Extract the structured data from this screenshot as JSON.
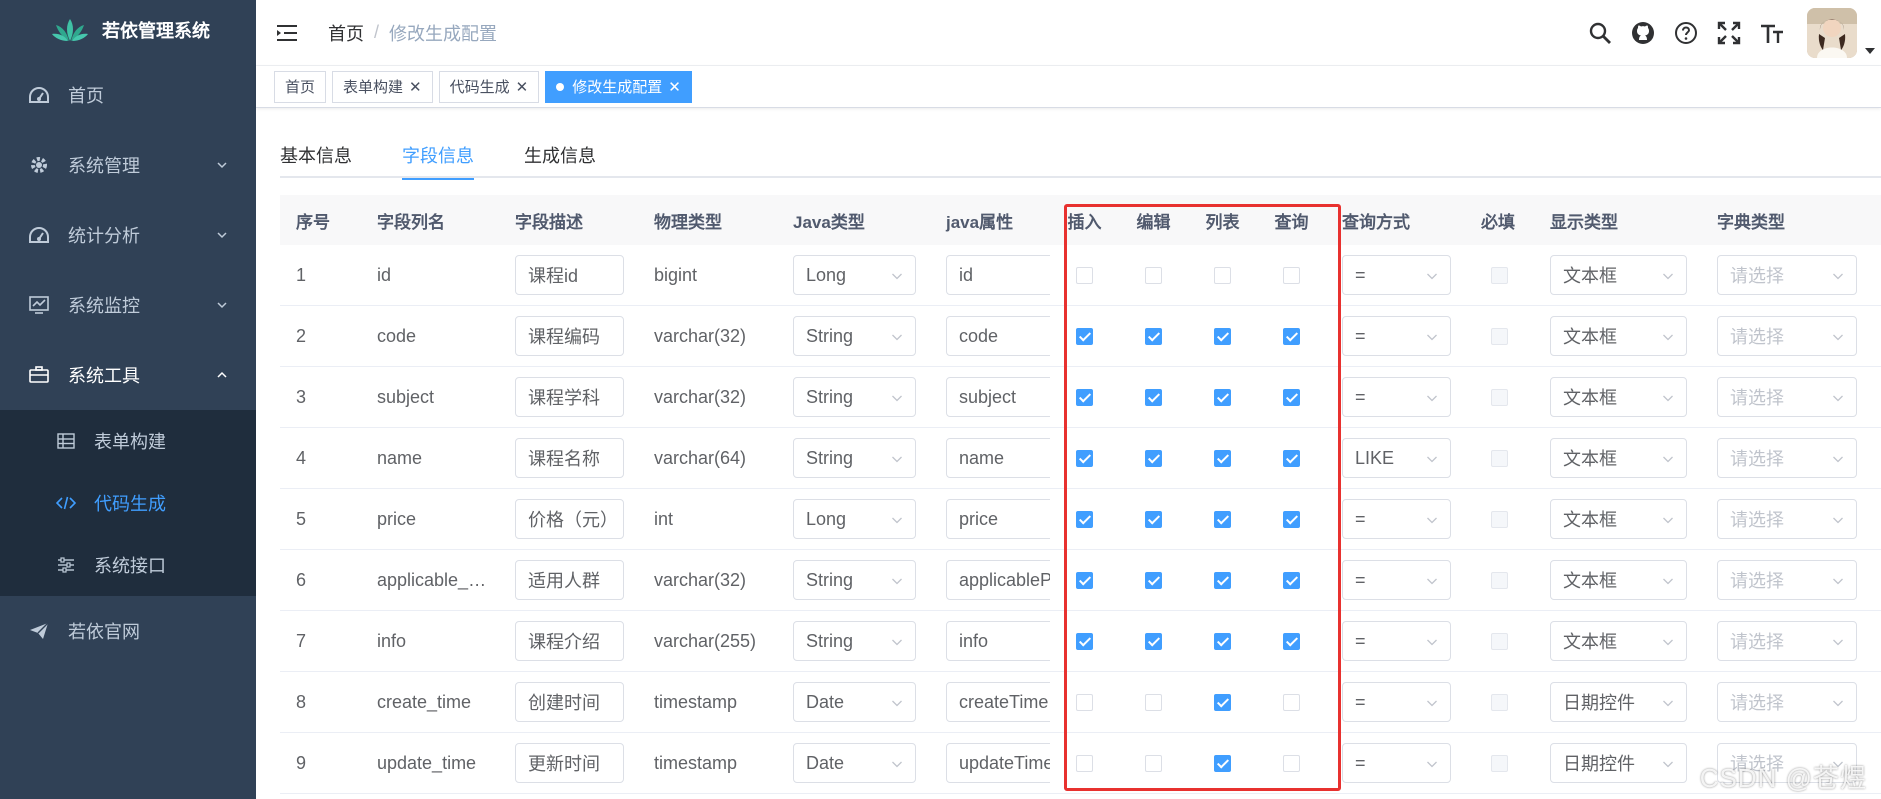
{
  "app": {
    "title": "若依管理系统"
  },
  "sidebar": {
    "items": [
      {
        "label": "首页",
        "icon": "dashboard-icon"
      },
      {
        "label": "系统管理",
        "icon": "gear-icon"
      },
      {
        "label": "统计分析",
        "icon": "dashboard-icon"
      },
      {
        "label": "系统监控",
        "icon": "monitor-icon"
      },
      {
        "label": "系统工具",
        "icon": "toolbox-icon",
        "expanded": true
      }
    ],
    "subitems": [
      {
        "label": "表单构建",
        "icon": "table-icon"
      },
      {
        "label": "代码生成",
        "icon": "code-icon",
        "active": true
      },
      {
        "label": "系统接口",
        "icon": "sliders-icon"
      }
    ],
    "external": {
      "label": "若依官网",
      "icon": "send-icon"
    }
  },
  "breadcrumb": {
    "home": "首页",
    "sep": "/",
    "current": "修改生成配置"
  },
  "tags": [
    {
      "label": "首页",
      "closable": false
    },
    {
      "label": "表单构建",
      "closable": true
    },
    {
      "label": "代码生成",
      "closable": true
    },
    {
      "label": "修改生成配置",
      "closable": true,
      "active": true
    }
  ],
  "tabs": [
    "基本信息",
    "字段信息",
    "生成信息"
  ],
  "table": {
    "headers": [
      "序号",
      "字段列名",
      "字段描述",
      "物理类型",
      "Java类型",
      "java属性",
      "插入",
      "编辑",
      "列表",
      "查询",
      "查询方式",
      "必填",
      "显示类型",
      "字典类型"
    ],
    "dict_placeholder": "请选择",
    "rows": [
      {
        "no": "1",
        "col": "id",
        "desc": "课程id",
        "phys": "bigint",
        "jtype": "Long",
        "jprop": "id",
        "ins": false,
        "edit": false,
        "list": false,
        "query": false,
        "qtype": "=",
        "req": false,
        "disp": "文本框"
      },
      {
        "no": "2",
        "col": "code",
        "desc": "课程编码",
        "phys": "varchar(32)",
        "jtype": "String",
        "jprop": "code",
        "ins": true,
        "edit": true,
        "list": true,
        "query": true,
        "qtype": "=",
        "req": false,
        "disp": "文本框"
      },
      {
        "no": "3",
        "col": "subject",
        "desc": "课程学科",
        "phys": "varchar(32)",
        "jtype": "String",
        "jprop": "subject",
        "ins": true,
        "edit": true,
        "list": true,
        "query": true,
        "qtype": "=",
        "req": false,
        "disp": "文本框"
      },
      {
        "no": "4",
        "col": "name",
        "desc": "课程名称",
        "phys": "varchar(64)",
        "jtype": "String",
        "jprop": "name",
        "ins": true,
        "edit": true,
        "list": true,
        "query": true,
        "qtype": "LIKE",
        "req": false,
        "disp": "文本框"
      },
      {
        "no": "5",
        "col": "price",
        "desc": "价格（元）",
        "phys": "int",
        "jtype": "Long",
        "jprop": "price",
        "ins": true,
        "edit": true,
        "list": true,
        "query": true,
        "qtype": "=",
        "req": false,
        "disp": "文本框"
      },
      {
        "no": "6",
        "col": "applicable_…",
        "desc": "适用人群",
        "phys": "varchar(32)",
        "jtype": "String",
        "jprop": "applicablePerson",
        "ins": true,
        "edit": true,
        "list": true,
        "query": true,
        "qtype": "=",
        "req": false,
        "disp": "文本框"
      },
      {
        "no": "7",
        "col": "info",
        "desc": "课程介绍",
        "phys": "varchar(255)",
        "jtype": "String",
        "jprop": "info",
        "ins": true,
        "edit": true,
        "list": true,
        "query": true,
        "qtype": "=",
        "req": false,
        "disp": "文本框"
      },
      {
        "no": "8",
        "col": "create_time",
        "desc": "创建时间",
        "phys": "timestamp",
        "jtype": "Date",
        "jprop": "createTime",
        "ins": false,
        "edit": false,
        "list": true,
        "query": false,
        "qtype": "=",
        "req": false,
        "disp": "日期控件"
      },
      {
        "no": "9",
        "col": "update_time",
        "desc": "更新时间",
        "phys": "timestamp",
        "jtype": "Date",
        "jprop": "updateTime",
        "ins": false,
        "edit": false,
        "list": true,
        "query": false,
        "qtype": "=",
        "req": false,
        "disp": "日期控件"
      }
    ]
  },
  "watermark": "CSDN @苍煜",
  "colors": {
    "sidebar_bg": "#304156",
    "accent": "#409eff",
    "highlight": "#e8312f"
  }
}
